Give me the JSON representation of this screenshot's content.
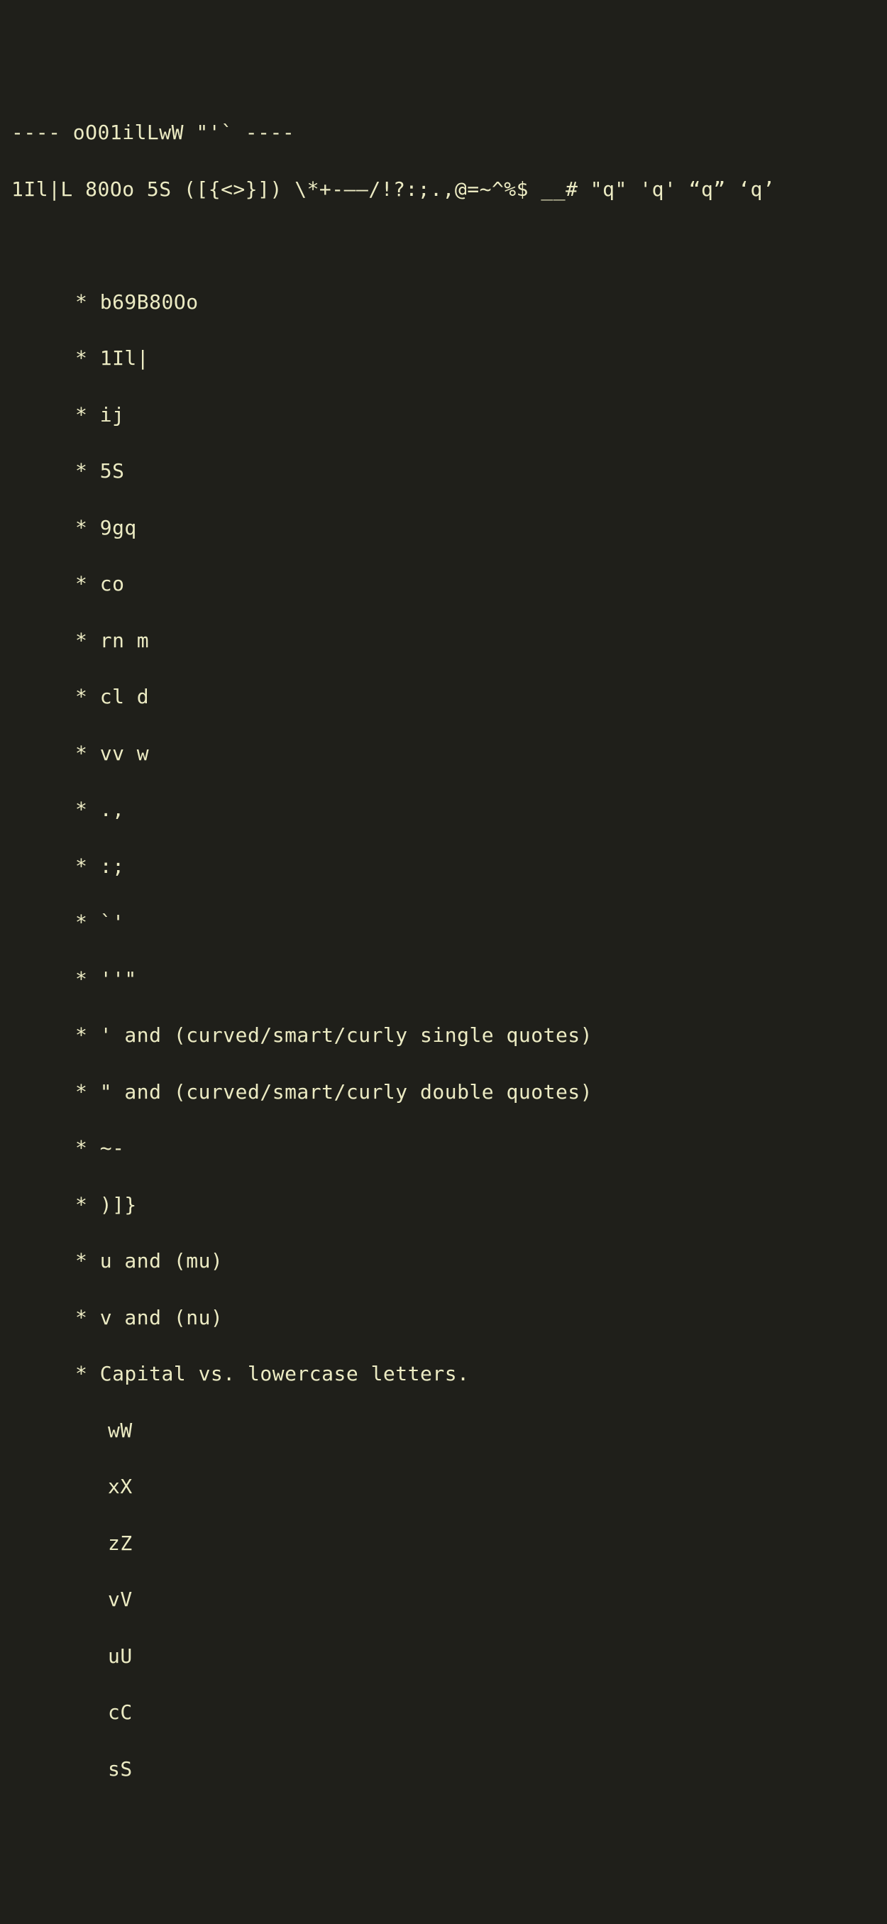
{
  "header": {
    "line1": "---- oO01ilLwW \"'` ----",
    "line2": "1Il|L 80Oo 5S ([{<>}]) \\*+-——/!?:;.,@=~^%$ __# \"q\" 'q' “q” ‘q’"
  },
  "items": [
    "* b69B80Oo",
    "* 1Il|",
    "* ij",
    "* 5S",
    "* 9gq",
    "* co",
    "* rn m",
    "* cl d",
    "* vv w",
    "* .,",
    "* :;",
    "* `'",
    "* ''\"",
    "* ' and (curved/smart/curly single quotes)",
    "* \" and (curved/smart/curly double quotes)",
    "* ~-",
    "* )]}",
    "* u and (mu)",
    "* v and (nu)",
    "* Capital vs. lowercase letters."
  ],
  "subitems": [
    "wW",
    "xX",
    "zZ",
    "vV",
    "uU",
    "cC",
    "sS"
  ]
}
